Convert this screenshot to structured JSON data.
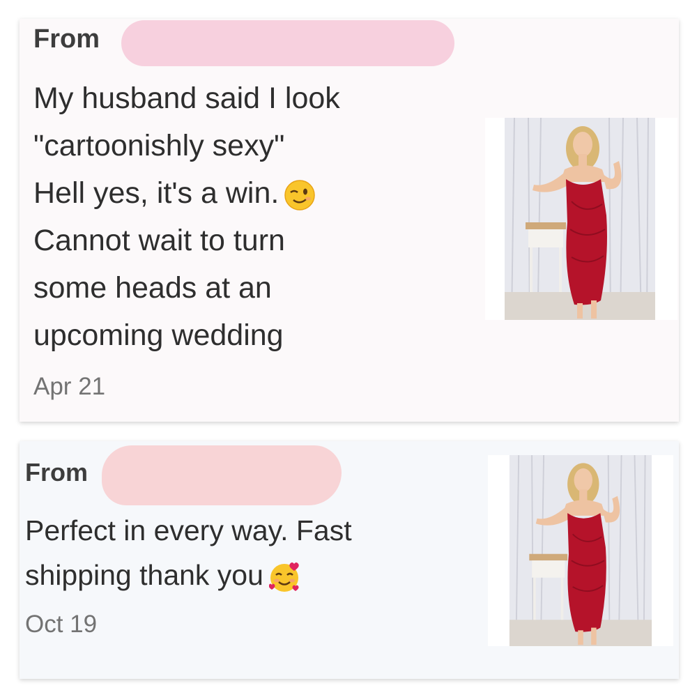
{
  "reviews": [
    {
      "from_label": "From",
      "lines": [
        "My husband said I look",
        "\"cartoonishly sexy\"",
        "Hell yes, it's a win.",
        "Cannot wait to turn",
        "some heads at an",
        "upcoming wedding"
      ],
      "emoji": "winking-face-icon",
      "date": "Apr 21",
      "product_image": "red-bodycon-dress-photo"
    },
    {
      "from_label": "From",
      "lines": [
        "Perfect in every way. Fast",
        "shipping thank you"
      ],
      "emoji": "smiling-face-with-hearts-icon",
      "date": "Oct 19",
      "product_image": "red-bodycon-dress-photo"
    }
  ],
  "colors": {
    "redaction": "#f7d0de",
    "dress": "#b5132a"
  }
}
